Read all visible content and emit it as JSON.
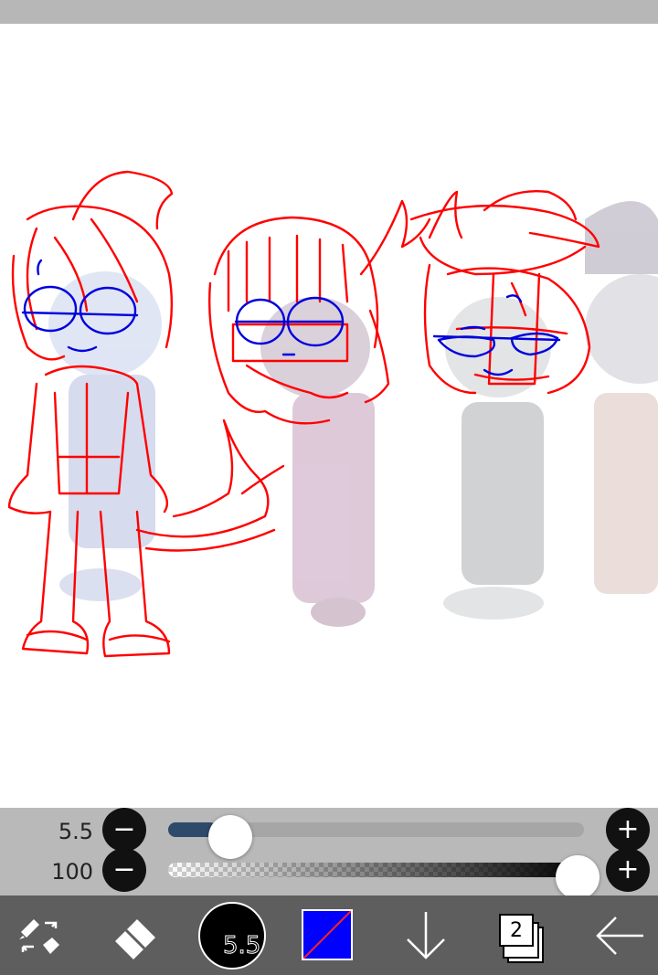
{
  "brush_size": {
    "value_label": "5.5",
    "slider_fraction": 0.1,
    "minus_label": "−",
    "plus_label": "+"
  },
  "opacity": {
    "value_label": "100",
    "slider_fraction": 1.0,
    "minus_label": "−",
    "plus_label": "+"
  },
  "toolbar": {
    "brush_size_label": "5.5",
    "layer_count": "2",
    "tools": [
      "transform-tool-icon",
      "eraser-icon",
      "brush-preview",
      "color-swatch",
      "download-arrow-icon",
      "layers-icon",
      "back-arrow-icon"
    ]
  },
  "colors": {
    "primary_color": "#0000ff",
    "stroke_red": "#ff0000",
    "stroke_blue": "#0000dd",
    "toolbar_bg": "#5e5e5e",
    "slider_panel_bg": "#b9b9b9"
  }
}
